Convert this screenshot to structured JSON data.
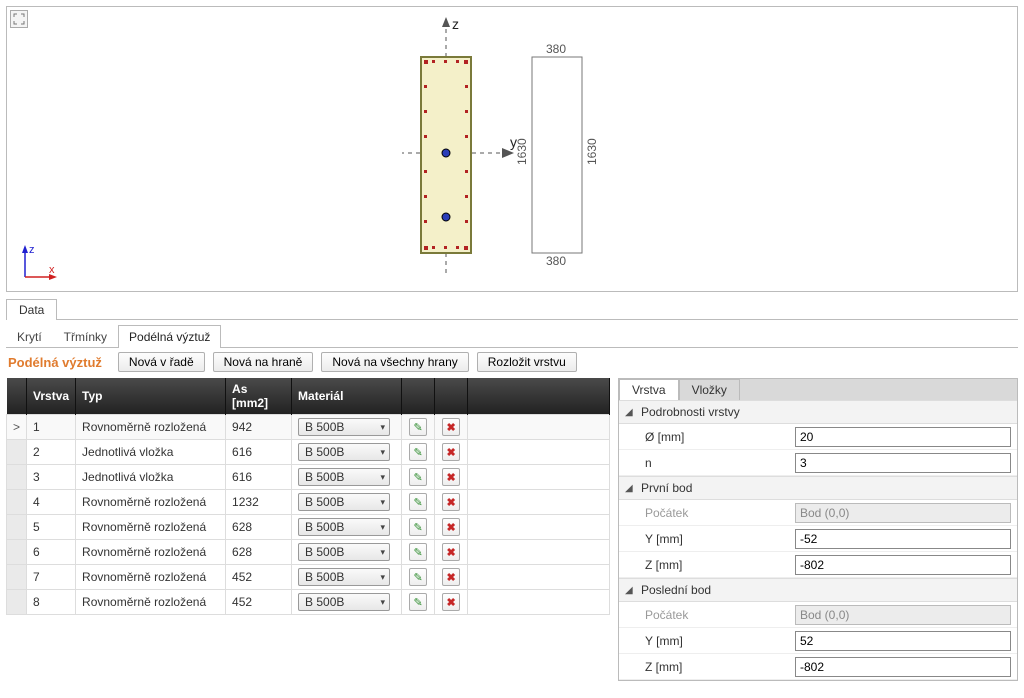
{
  "viewport": {
    "axis_z": "z",
    "axis_y": "y",
    "axis_x": "x",
    "dim_width": "380",
    "dim_height": "1630",
    "dim_width2": "380",
    "dim_height2": "1630"
  },
  "main_tab": "Data",
  "subtabs": {
    "kryti": "Krytí",
    "trmínky": "Třmínky",
    "podelna": "Podélná výztuž"
  },
  "section_title": "Podélná výztuž",
  "buttons": {
    "nova_v_rade": "Nová v řadě",
    "nova_na_hrane": "Nová na hraně",
    "nova_na_vsechny_hrany": "Nová na všechny hrany",
    "rozlozit_vrstvu": "Rozložit vrstvu"
  },
  "table": {
    "headers": {
      "ind": "",
      "vrstva": "Vrstva",
      "typ": "Typ",
      "as": "As [mm2]",
      "material": "Materiál",
      "b1": "",
      "b2": ""
    },
    "rows": [
      {
        "ind": ">",
        "vrstva": "1",
        "typ": "Rovnoměrně rozložená",
        "as": "942",
        "mat": "B 500B"
      },
      {
        "ind": "",
        "vrstva": "2",
        "typ": "Jednotlivá vložka",
        "as": "616",
        "mat": "B 500B"
      },
      {
        "ind": "",
        "vrstva": "3",
        "typ": "Jednotlivá vložka",
        "as": "616",
        "mat": "B 500B"
      },
      {
        "ind": "",
        "vrstva": "4",
        "typ": "Rovnoměrně rozložená",
        "as": "1232",
        "mat": "B 500B"
      },
      {
        "ind": "",
        "vrstva": "5",
        "typ": "Rovnoměrně rozložená",
        "as": "628",
        "mat": "B 500B"
      },
      {
        "ind": "",
        "vrstva": "6",
        "typ": "Rovnoměrně rozložená",
        "as": "628",
        "mat": "B 500B"
      },
      {
        "ind": "",
        "vrstva": "7",
        "typ": "Rovnoměrně rozložená",
        "as": "452",
        "mat": "B 500B"
      },
      {
        "ind": "",
        "vrstva": "8",
        "typ": "Rovnoměrně rozložená",
        "as": "452",
        "mat": "B 500B"
      }
    ]
  },
  "props": {
    "tab_vrstva": "Vrstva",
    "tab_vlozky": "Vložky",
    "grp_detail": "Podrobnosti vrstvy",
    "diam_label": "Ø [mm]",
    "diam_value": "20",
    "n_label": "n",
    "n_value": "3",
    "grp_first": "První bod",
    "pocatek_label": "Počátek",
    "pocatek_value": "Bod (0,0)",
    "y_label": "Y [mm]",
    "z_label": "Z [mm]",
    "first_y": "-52",
    "first_z": "-802",
    "grp_last": "Poslední bod",
    "last_y": "52",
    "last_z": "-802"
  }
}
